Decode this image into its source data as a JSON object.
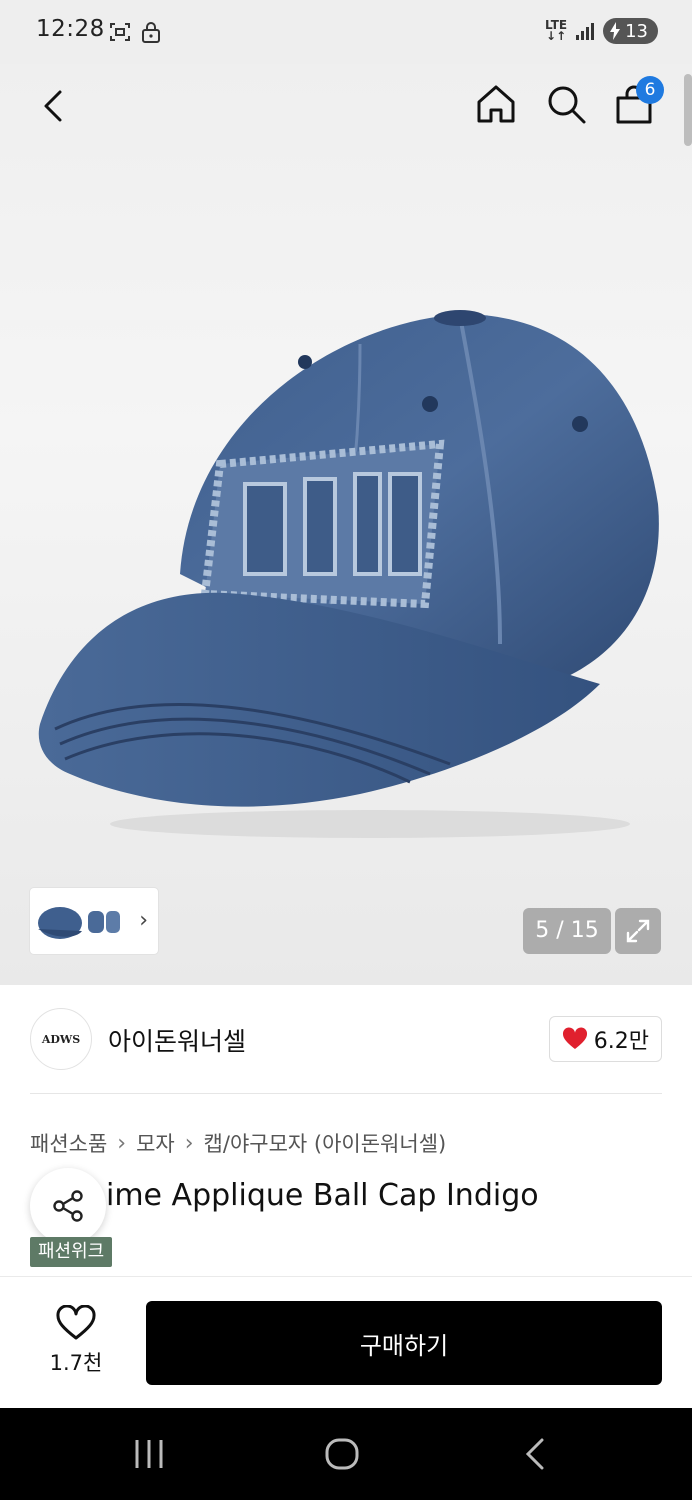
{
  "status_bar": {
    "time": "12:28",
    "network": "LTE",
    "battery": "13"
  },
  "nav": {
    "cart_count": "6"
  },
  "gallery": {
    "counter": "5 / 15",
    "thumb_chevron": "›"
  },
  "brand": {
    "logo_text": "ADWS",
    "name": "아이돈워너셀",
    "like_count": "6.2만"
  },
  "product": {
    "breadcrumb": [
      "패션소품",
      "모자",
      "캡/야구모자 (아이돈워너셀)"
    ],
    "breadcrumb_sep": "›",
    "title": "ime Applique Ball Cap Indigo",
    "tag": "패션위크"
  },
  "bottom_bar": {
    "wish_count": "1.7천",
    "buy_label": "구매하기"
  },
  "colors": {
    "accent_badge": "#1f7ae0",
    "tag_bg": "#5e7a66",
    "heart": "#e0202e",
    "buy_bg": "#000000"
  }
}
